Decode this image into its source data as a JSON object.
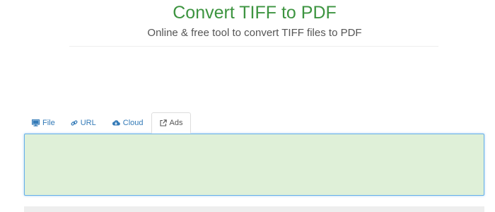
{
  "header": {
    "title": "Convert TIFF to PDF",
    "subtitle": "Online & free tool to convert TIFF files to PDF"
  },
  "tabs": [
    {
      "label": "File",
      "icon": "monitor-icon",
      "active": false
    },
    {
      "label": "URL",
      "icon": "link-icon",
      "active": false
    },
    {
      "label": "Cloud",
      "icon": "cloud-icon",
      "active": false
    },
    {
      "label": "Ads",
      "icon": "external-link-icon",
      "active": true
    }
  ],
  "colors": {
    "title": "#3d9440",
    "tab_link": "#337ab7",
    "panel_background": "#dff0d8",
    "panel_border": "#66afe9"
  }
}
